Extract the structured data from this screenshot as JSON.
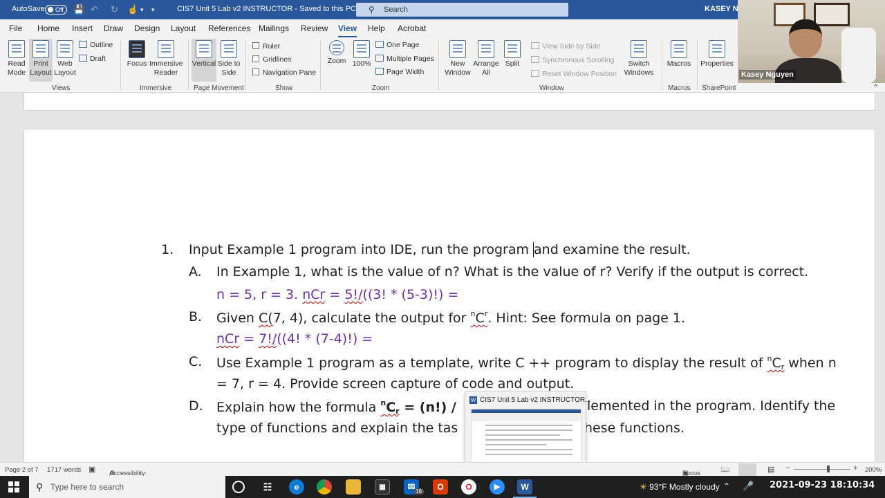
{
  "titlebar": {
    "autosave_label": "AutoSave",
    "autosave_state": "Off",
    "doc_title": "CIS7 Unit 5 Lab v2 INSTRUCTOR  -  Saved to this PC",
    "search_placeholder": "Search",
    "user_short": "KASEY NGU"
  },
  "menu": [
    "File",
    "Home",
    "Insert",
    "Draw",
    "Design",
    "Layout",
    "References",
    "Mailings",
    "Review",
    "View",
    "Help",
    "Acrobat"
  ],
  "menu_active": "View",
  "ribbon": {
    "views": {
      "read_mode": "Read Mode",
      "print_layout": "Print Layout",
      "web_layout": "Web Layout",
      "outline": "Outline",
      "draft": "Draft",
      "group": "Views"
    },
    "immersive": {
      "focus": "Focus",
      "reader": "Immersive Reader",
      "group": "Immersive"
    },
    "page_movement": {
      "vertical": "Vertical",
      "side": "Side to Side",
      "group": "Page Movement"
    },
    "show": {
      "ruler": "Ruler",
      "gridlines": "Gridlines",
      "nav": "Navigation Pane",
      "group": "Show"
    },
    "zoom": {
      "zoom": "Zoom",
      "hundred": "100%",
      "one_page": "One Page",
      "multiple": "Multiple Pages",
      "width": "Page Width",
      "group": "Zoom"
    },
    "window": {
      "new": "New Window",
      "arrange": "Arrange All",
      "split": "Split",
      "side_by_side": "View Side by Side",
      "sync": "Synchronous Scrolling",
      "reset": "Reset Window Position",
      "switch": "Switch Windows",
      "group": "Window"
    },
    "macros": {
      "macros": "Macros",
      "group": "Macros"
    },
    "sharepoint": {
      "properties": "Properties",
      "group": "SharePoint"
    }
  },
  "webcam": {
    "name": "Kasey Nguyen"
  },
  "document": {
    "q1_num": "1.",
    "q1_text_a": "Input Example 1 program into IDE, run the program ",
    "q1_text_b": "and examine the result.",
    "a_label": "A.",
    "a_text": "In Example 1, what is the value of n? What is the value of r? Verify if the output is correct.",
    "a_answer_1": "n = 5, r = 3. ",
    "a_answer_ncr": "nCr",
    "a_answer_2": " = ",
    "a_answer_3": "5!/",
    "a_answer_4": "((3! * (5-3)!) =",
    "b_label": "B.",
    "b_text_1": "Given ",
    "b_text_c": "C(",
    "b_text_2": "7, 4), calculate the output for ",
    "b_sup_n": "n",
    "b_C": "C",
    "b_sup_r": "r",
    "b_text_3": ". Hint: See formula on page 1.",
    "b_answer_ncr": "nCr",
    "b_answer_2": " = ",
    "b_answer_3": "7!/",
    "b_answer_4": "((4! * (7-4)!) =",
    "c_label": "C.",
    "c_text_1": "Use Example 1 program as a template, write C ++ program to display the result of ",
    "c_sup_n": "n",
    "c_C": "C",
    "c_sub_r": "r",
    "c_text_2": " when n",
    "c_text_3": "= 7, r = 4. Provide screen capture of code and output.",
    "d_label": "D.",
    "d_text_1": "Explain how the formula ",
    "d_sup_n": "n",
    "d_C": "C",
    "d_sub_r": "r",
    "d_text_2": " = (n!) / ",
    "d_text_3": "lemented in the program. Identify the",
    "d_text_4": "type of functions and explain the tas",
    "d_text_5": "hese functions."
  },
  "thumbnail": {
    "title": "CIS7 Unit 5 Lab v2 INSTRUCTOR..."
  },
  "statusbar": {
    "page": "Page 2 of 7",
    "words": "1717 words",
    "accessibility": "Accessibility: Good to go",
    "focus": "Focus",
    "zoom": "200%"
  },
  "taskbar": {
    "search_placeholder": "Type here to search",
    "mail_badge": "16",
    "weather": "93°F  Mostly cloudy",
    "timestamp": "2021-09-23 18:10:34"
  },
  "colors": {
    "word_blue": "#2b579a",
    "answer_purple": "#7030a0",
    "spell_red": "#c00000"
  }
}
